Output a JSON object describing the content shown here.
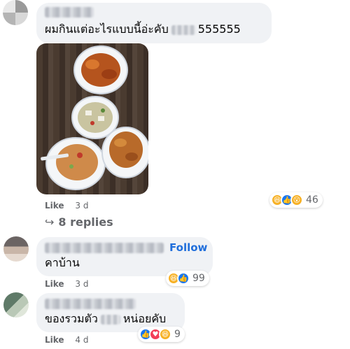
{
  "comments": [
    {
      "text_before": "ผมกินแต่อะไรแบบนี้อ่ะคับ",
      "text_after": "555555",
      "meta": {
        "like": "Like",
        "time": "3 d"
      },
      "reactions": {
        "icons": [
          "haha-icon",
          "like-icon",
          "wow-icon"
        ],
        "count": "46"
      },
      "replies_label": "8 replies"
    },
    {
      "follow": "Follow",
      "text": "คาบ้าน",
      "meta": {
        "like": "Like",
        "time": "3 d"
      },
      "reactions": {
        "icons": [
          "haha-icon",
          "like-icon"
        ],
        "count": "99"
      }
    },
    {
      "text_before": "ของรวมตัว",
      "text_after": "หน่อยคับ",
      "meta": {
        "like": "Like",
        "time": "4 d"
      },
      "reactions": {
        "icons": [
          "like-icon",
          "love-icon",
          "haha-icon"
        ],
        "count": "9"
      }
    }
  ],
  "colors": {
    "bubble": "#f0f2f5",
    "follow": "#216fdb",
    "meta": "#65676b",
    "like": "#1877f2",
    "haha": "#f7b125",
    "love": "#f33e58"
  }
}
